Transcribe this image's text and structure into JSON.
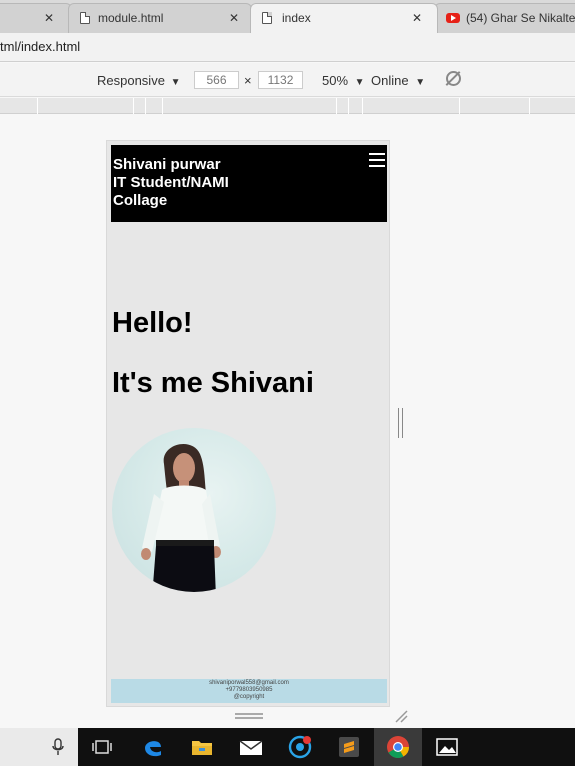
{
  "browser": {
    "tabs": [
      {
        "label": "",
        "active": false
      },
      {
        "label": "module.html",
        "active": false
      },
      {
        "label": "index",
        "active": true
      },
      {
        "label": "(54) Ghar Se Nikalte",
        "active": false
      }
    ],
    "close_glyph": "✕",
    "url": "tml/index.html"
  },
  "devtools": {
    "device_mode": "Responsive",
    "width": "566",
    "height": "1132",
    "times": "×",
    "zoom": "50%",
    "throttle": "Online",
    "dropdown_glyph": "▼"
  },
  "site": {
    "header_line1": "Shivani purwar",
    "header_line2": "IT Student/NAMI",
    "header_line3": "Collage",
    "hello": "Hello!",
    "its_me": "It's me Shivani",
    "footer_email": "shivaniporwal558@gmail.com",
    "footer_phone": "+9779803950985",
    "footer_copyright": "@copyright"
  },
  "colors": {
    "header_bg": "#000000",
    "footer_bg": "#b9dbe6",
    "page_bg": "#e7e7e7"
  },
  "taskbar": {
    "icons": [
      "microphone-icon",
      "task-view-icon",
      "edge-icon",
      "file-explorer-icon",
      "mail-icon",
      "app-icon",
      "sublime-icon",
      "chrome-icon",
      "photos-icon"
    ]
  }
}
